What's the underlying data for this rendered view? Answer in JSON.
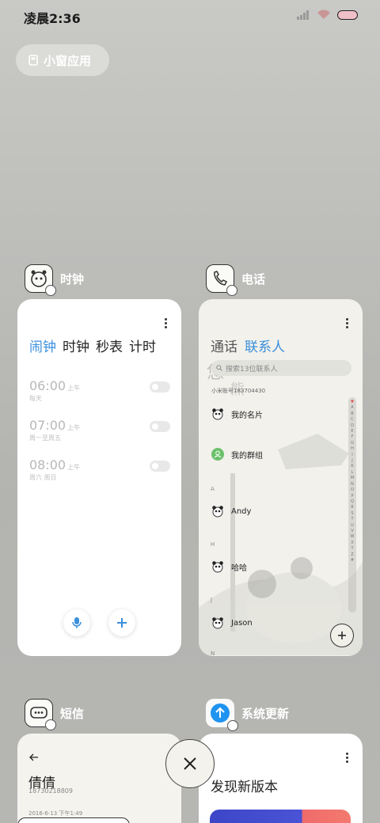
{
  "status_bar": {
    "time": "凌晨2:36"
  },
  "mini_window": {
    "label": "小窗应用"
  },
  "apps": {
    "clock": {
      "name": "时钟",
      "tabs": [
        "闹钟",
        "时钟",
        "秒表",
        "计时"
      ],
      "alarms": [
        {
          "time": "06:00",
          "ampm": "上午",
          "repeat": "每天"
        },
        {
          "time": "07:00",
          "ampm": "上午",
          "repeat": "周一至周五"
        },
        {
          "time": "08:00",
          "ampm": "上午",
          "repeat": "周六 周日"
        }
      ]
    },
    "phone": {
      "name": "电话",
      "tabs": [
        "通话",
        "联系人"
      ],
      "search_placeholder": "搜索13位联系人",
      "account": "小米账号183704430",
      "contacts": {
        "my_card": "我的名片",
        "my_groups": "我的群组",
        "andy": "Andy",
        "haha": "哈哈",
        "jason": "Jason"
      },
      "sections": {
        "a": "A",
        "h": "H",
        "j": "J",
        "n": "N"
      },
      "index_letters": [
        "♥",
        "A",
        "B",
        "C",
        "D",
        "E",
        "F",
        "G",
        "H",
        "I",
        "J",
        "K",
        "L",
        "M",
        "N",
        "O",
        "P",
        "Q",
        "R",
        "S",
        "T",
        "U",
        "V",
        "W",
        "X",
        "Y",
        "Z",
        "#"
      ]
    },
    "messages": {
      "name": "短信",
      "contact_name": "倩倩",
      "contact_number": "18730218809",
      "timestamp": "2016-6-13 下午1:49"
    },
    "update": {
      "name": "系统更新",
      "title": "发现新版本"
    }
  },
  "colors": {
    "accent": "#3b8fdc"
  }
}
